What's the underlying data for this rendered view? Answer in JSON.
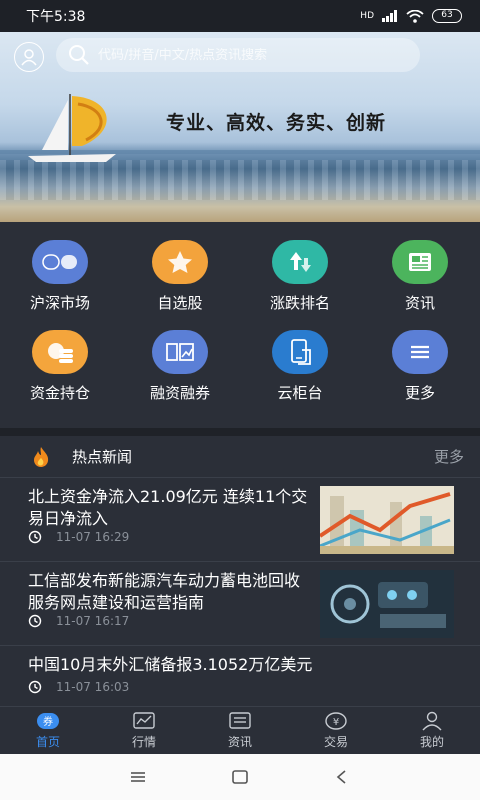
{
  "status": {
    "time": "下午5:38",
    "network": "HD",
    "battery": "63"
  },
  "header": {
    "search_placeholder": "代码/拼音/中文/热点资讯搜索",
    "slogan": "专业、高效、务实、创新"
  },
  "menu": [
    {
      "label": "沪深市场",
      "icon": "hushen-icon",
      "color": "#5b7fd6"
    },
    {
      "label": "自选股",
      "icon": "star-icon",
      "color": "#f3a33c"
    },
    {
      "label": "涨跌排名",
      "icon": "updown-icon",
      "color": "#2fb8a5"
    },
    {
      "label": "资讯",
      "icon": "news-icon",
      "color": "#4cb45d"
    },
    {
      "label": "资金持仓",
      "icon": "coins-icon",
      "color": "#f4a53c"
    },
    {
      "label": "融资融券",
      "icon": "margin-icon",
      "color": "#5b7fd6"
    },
    {
      "label": "云柜台",
      "icon": "cloud-counter-icon",
      "color": "#2a7ccf"
    },
    {
      "label": "更多",
      "icon": "more-icon",
      "color": "#5b7fd6"
    }
  ],
  "hot_news": {
    "title": "热点新闻",
    "more": "更多",
    "items": [
      {
        "title": "北上资金净流入21.09亿元 连续11个交易日净流入",
        "time": "11-07 16:29"
      },
      {
        "title": "工信部发布新能源汽车动力蓄电池回收服务网点建设和运营指南",
        "time": "11-07 16:17"
      },
      {
        "title": "中国10月末外汇储备报3.1052万亿美元",
        "time": "11-07 16:03"
      }
    ]
  },
  "tabs": [
    {
      "label": "首页",
      "icon": "home-coupon-icon",
      "active": true
    },
    {
      "label": "行情",
      "icon": "chart-icon",
      "active": false
    },
    {
      "label": "资讯",
      "icon": "news-icon",
      "active": false
    },
    {
      "label": "交易",
      "icon": "yuan-icon",
      "active": false
    },
    {
      "label": "我的",
      "icon": "user-icon",
      "active": false
    }
  ],
  "accent_color": "#3b8ef0"
}
